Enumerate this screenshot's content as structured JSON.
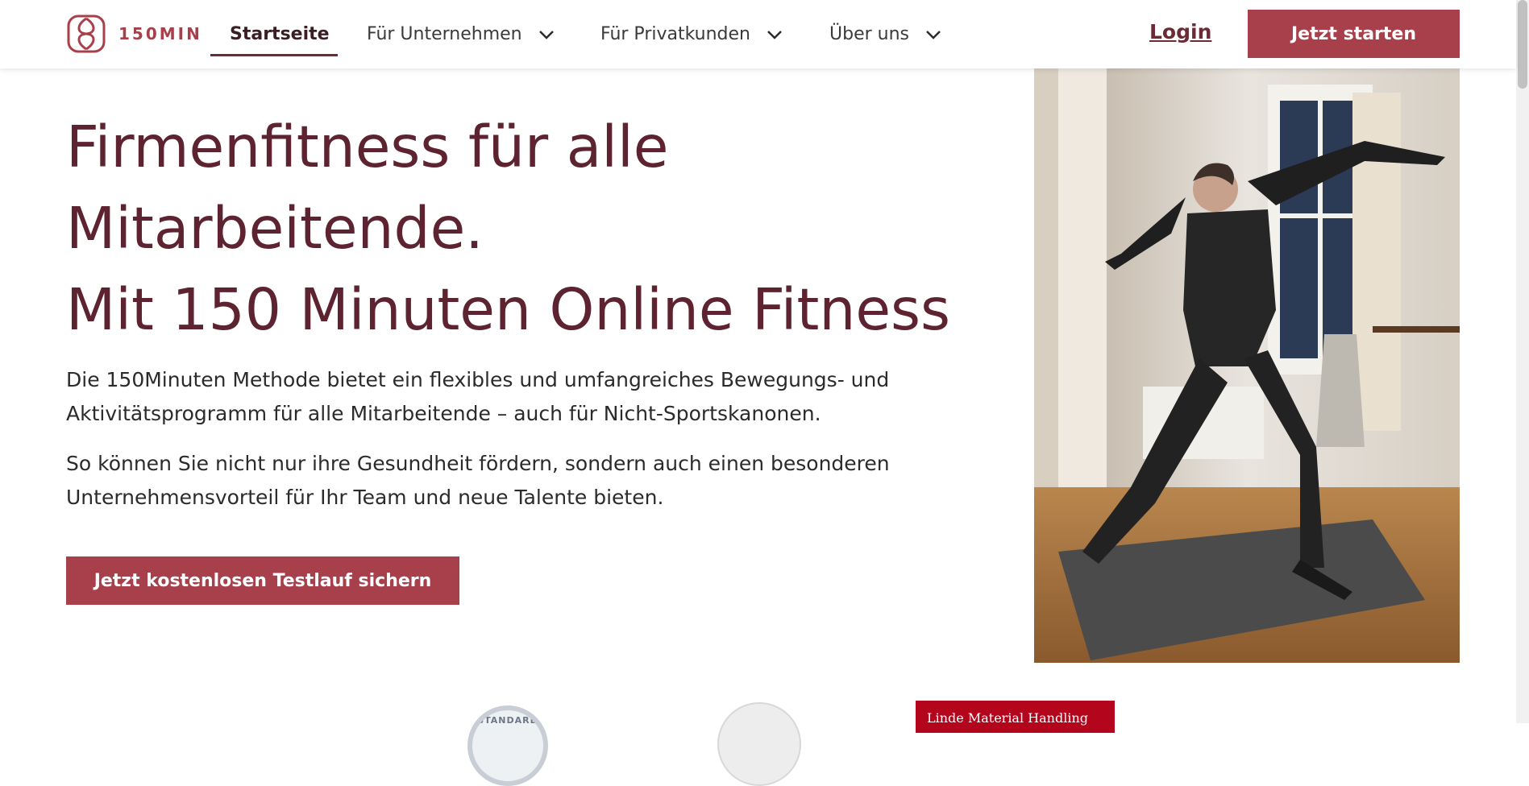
{
  "brand": {
    "name": "150MIN",
    "accent": "#a8404c",
    "dark": "#5d2330"
  },
  "nav": {
    "items": [
      {
        "label": "Startseite",
        "active": true
      },
      {
        "label": "Für Unternehmen",
        "icon": "chevron-down-icon"
      },
      {
        "label": "Für Privatkunden",
        "icon": "chevron-down-icon"
      },
      {
        "label": "Über uns",
        "icon": "chevron-down-icon"
      }
    ],
    "login_label": "Login",
    "cta_label": "Jetzt starten"
  },
  "hero": {
    "headline_lines": [
      "Firmenfitness für alle",
      "Mitarbeitende.",
      "Mit 150 Minuten Online Fitness"
    ],
    "paragraphs": [
      "Die 150Minuten Methode bietet ein flexibles und umfangreiches Bewegungs- und Aktivitätsprogramm für alle Mitarbeitende – auch für Nicht-Sportskanonen.",
      "So können Sie nicht nur ihre Gesundheit fördern, sondern auch einen besonderen Unternehmensvorteil für Ihr Team und neue Talente bieten."
    ],
    "cta_label": "Jetzt kostenlosen Testlauf sichern",
    "image_alt": "woman-yoga-warrior-pose-photo"
  },
  "partners": {
    "badge_text": "STANDARD",
    "linde_text": "Linde Material Handling"
  }
}
